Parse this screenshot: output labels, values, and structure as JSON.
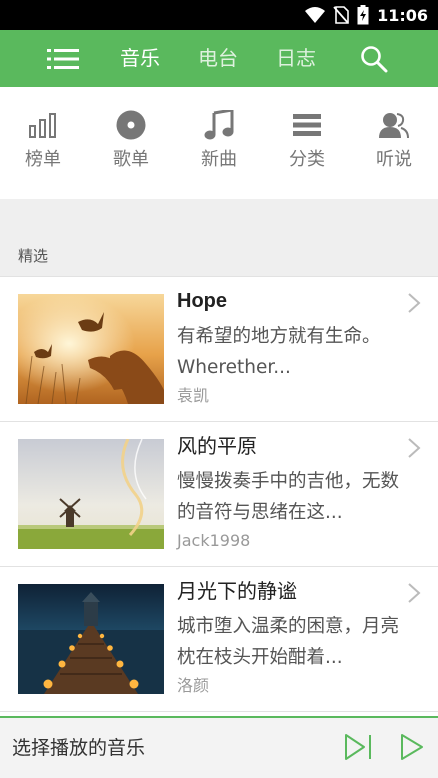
{
  "status_bar": {
    "time": "11:06",
    "icons": [
      "wifi-icon",
      "no-sim-icon",
      "battery-charging-icon"
    ]
  },
  "app_bar": {
    "menu_icon": "menu-icon",
    "tabs": [
      {
        "label": "音乐",
        "active": true
      },
      {
        "label": "电台",
        "active": false
      },
      {
        "label": "日志",
        "active": false
      }
    ],
    "search_icon": "search-icon"
  },
  "categories": [
    {
      "label": "榜单",
      "icon": "chart-bars-icon"
    },
    {
      "label": "歌单",
      "icon": "disc-icon"
    },
    {
      "label": "新曲",
      "icon": "music-note-icon"
    },
    {
      "label": "分类",
      "icon": "list-lines-icon"
    },
    {
      "label": "听说",
      "icon": "people-icon"
    }
  ],
  "section": {
    "title": "精选"
  },
  "items": [
    {
      "title": "Hope",
      "desc_line1": "有希望的地方就有生命。",
      "desc_line2": "Wherether...",
      "author": "袁凯"
    },
    {
      "title": "风的平原",
      "desc_line1": "慢慢拨奏手中的吉他，无数",
      "desc_line2": "的音符与思绪在这...",
      "author": "Jack1998"
    },
    {
      "title": "月光下的静谧",
      "desc_line1": "城市堕入温柔的困意，月亮",
      "desc_line2": "枕在枝头开始酣着...",
      "author": "洛颜"
    }
  ],
  "player": {
    "now_playing": "选择播放的音乐",
    "next_icon": "skip-next-icon",
    "play_icon": "play-icon"
  },
  "colors": {
    "accent": "#5ab95d",
    "icon_gray": "#777777"
  }
}
